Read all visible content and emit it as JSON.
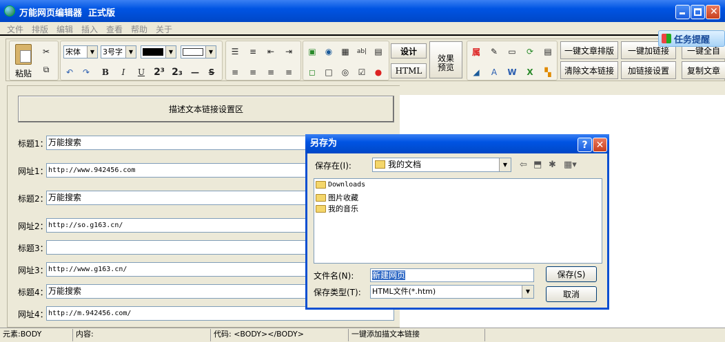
{
  "window": {
    "title": "万能网页编辑器  正式版"
  },
  "menu": [
    "文件",
    "排版",
    "编辑",
    "插入",
    "查看",
    "帮助",
    "关于"
  ],
  "toolbar": {
    "paste_label": "粘贴",
    "font_name": "宋体",
    "font_size": "3号字",
    "design_label": "设计",
    "html_label": "HTML",
    "preview_label": "效果\n预览",
    "attr_label": "属",
    "right_buttons": [
      "一键文章排版",
      "一键加链接",
      "一键全自",
      "清除文本链接",
      "加链接设置",
      "复制文章"
    ]
  },
  "task_reminder": "任务提醒",
  "left_panel": {
    "header": "描述文本链接设置区",
    "fields": [
      {
        "label": "标题1：",
        "value": "万能搜索",
        "mono": false
      },
      {
        "label": "网址1：",
        "value": "http://www.942456.com",
        "mono": true
      },
      {
        "label": "标题2：",
        "value": "万能搜索",
        "mono": false
      },
      {
        "label": "网址2：",
        "value": "http://so.g163.cn/",
        "mono": true
      },
      {
        "label": "标题3：",
        "value": "",
        "mono": false
      },
      {
        "label": "网址3：",
        "value": "http://www.g163.cn/",
        "mono": true
      },
      {
        "label": "标题4：",
        "value": "万能搜索",
        "mono": false
      },
      {
        "label": "网址4：",
        "value": "http://m.942456.com/",
        "mono": true
      }
    ]
  },
  "status_bar": {
    "element": "元素:BODY",
    "content": "内容:",
    "code": "代码:  <BODY></BODY>",
    "action": "一键添加描文本链接"
  },
  "dialog": {
    "title": "另存为",
    "save_in_label": "保存在(I):",
    "save_in_value": "我的文档",
    "files": [
      "Downloads",
      "图片收藏",
      "我的音乐"
    ],
    "filename_label": "文件名(N):",
    "filename_value": "新建网页",
    "filetype_label": "保存类型(T):",
    "filetype_value": "HTML文件(*.htm)",
    "save_button": "保存(S)",
    "cancel_button": "取消"
  }
}
